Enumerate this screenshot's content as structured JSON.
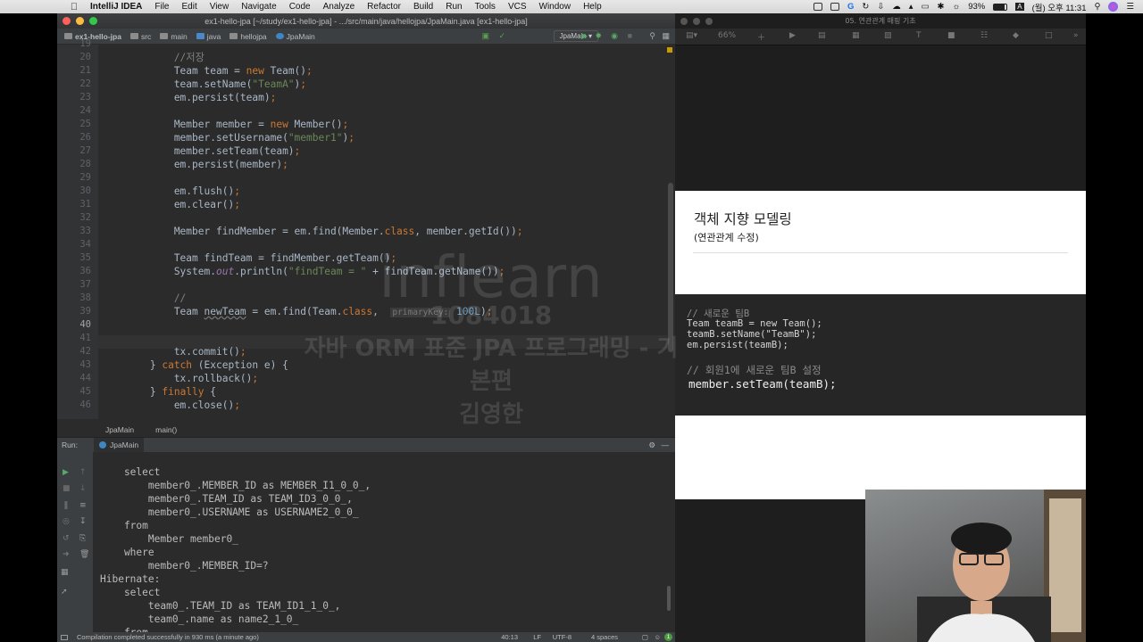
{
  "menubar": {
    "app_name": "IntelliJ IDEA",
    "items": [
      "File",
      "Edit",
      "View",
      "Navigate",
      "Code",
      "Analyze",
      "Refactor",
      "Build",
      "Run",
      "Tools",
      "VCS",
      "Window",
      "Help"
    ],
    "battery": "93%",
    "clock": "(월) 오후 11:31"
  },
  "ide": {
    "window_title": "ex1-hello-jpa [~/study/ex1-hello-jpa] - .../src/main/java/hellojpa/JpaMain.java [ex1-hello-jpa]",
    "breadcrumbs": [
      "ex1-hello-jpa",
      "src",
      "main",
      "java",
      "hellojpa",
      "JpaMain"
    ],
    "run_config": "JpaMain",
    "code_lines": [
      {
        "n": "19",
        "t": ""
      },
      {
        "n": "20",
        "t": "            //저장"
      },
      {
        "n": "21",
        "t": "            Team team = new Team();"
      },
      {
        "n": "22",
        "t": "            team.setName(\"TeamA\");"
      },
      {
        "n": "23",
        "t": "            em.persist(team);"
      },
      {
        "n": "24",
        "t": ""
      },
      {
        "n": "25",
        "t": "            Member member = new Member();"
      },
      {
        "n": "26",
        "t": "            member.setUsername(\"member1\");"
      },
      {
        "n": "27",
        "t": "            member.setTeam(team);"
      },
      {
        "n": "28",
        "t": "            em.persist(member);"
      },
      {
        "n": "29",
        "t": ""
      },
      {
        "n": "30",
        "t": "            em.flush();"
      },
      {
        "n": "31",
        "t": "            em.clear();"
      },
      {
        "n": "32",
        "t": ""
      },
      {
        "n": "33",
        "t": "            Member findMember = em.find(Member.class, member.getId());"
      },
      {
        "n": "34",
        "t": ""
      },
      {
        "n": "35",
        "t": "            Team findTeam = findMember.getTeam();"
      },
      {
        "n": "36",
        "t": "            System.out.println(\"findTeam = \" + findTeam.getName());"
      },
      {
        "n": "37",
        "t": ""
      },
      {
        "n": "38",
        "t": "            //"
      },
      {
        "n": "39",
        "t": "            Team newTeam = em.find(Team.class,  primaryKey: 100L);"
      },
      {
        "n": "40",
        "t": ""
      },
      {
        "n": "41",
        "t": ""
      },
      {
        "n": "42",
        "t": "            tx.commit();"
      },
      {
        "n": "43",
        "t": "        } catch (Exception e) {"
      },
      {
        "n": "44",
        "t": "            tx.rollback();"
      },
      {
        "n": "45",
        "t": "        } finally {"
      },
      {
        "n": "46",
        "t": "            em.close();"
      }
    ],
    "structure_crumbs": [
      "JpaMain",
      "main()"
    ],
    "run_label": "Run:",
    "run_tab": "JpaMain",
    "console_lines": [
      "    select",
      "        member0_.MEMBER_ID as MEMBER_I1_0_0_,",
      "        member0_.TEAM_ID as TEAM_ID3_0_0_,",
      "        member0_.USERNAME as USERNAME2_0_0_",
      "    from",
      "        Member member0_",
      "    where",
      "        member0_.MEMBER_ID=?",
      "Hibernate:",
      "    select",
      "        team0_.TEAM_ID as TEAM_ID1_1_0_,",
      "        team0_.name as name2_1_0_",
      "    from"
    ],
    "status_message": "Compilation completed successfully in 930 ms (a minute ago)",
    "cursor_pos": "40:13",
    "line_sep": "LF",
    "encoding": "UTF-8",
    "indent": "4 spaces"
  },
  "keynote": {
    "window_title": "05. 연관관계 매핑 기초",
    "zoom": "66%",
    "slide_title": "객체 지향 모델링",
    "slide_subtitle": "(연관관계 수정)",
    "code": {
      "l1": "// 새로운 팀B",
      "l2": "Team teamB = new Team();",
      "l3": "teamB.setName(\"TeamB\");",
      "l4": "em.persist(teamB);",
      "l5": "// 회원1에 새로운 팀B 설정",
      "l6": "member.setTeam(teamB);"
    }
  },
  "watermark": {
    "brand": "inflearn",
    "id": "1084018",
    "course": "자바 ORM 표준 JPA 프로그래밍 - 기본편",
    "author": "김영한"
  }
}
